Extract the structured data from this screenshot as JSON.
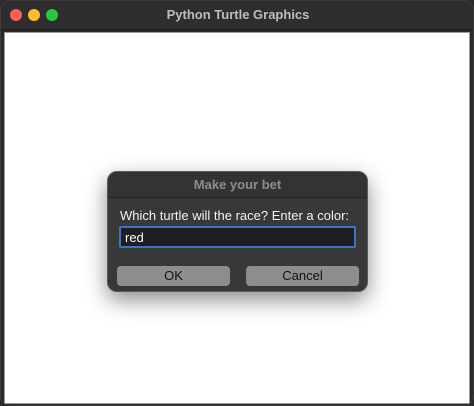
{
  "window": {
    "title": "Python Turtle Graphics",
    "controls": {
      "close_color": "#fe5f57",
      "minimize_color": "#febc2e",
      "maximize_color": "#28c840"
    }
  },
  "dialog": {
    "title": "Make your bet",
    "prompt": "Which turtle will the race? Enter a color:",
    "input_value": "red",
    "ok_label": "OK",
    "cancel_label": "Cancel"
  },
  "colors": {
    "canvas_background": "#ffffff",
    "input_focus_border": "#3e73c8"
  }
}
